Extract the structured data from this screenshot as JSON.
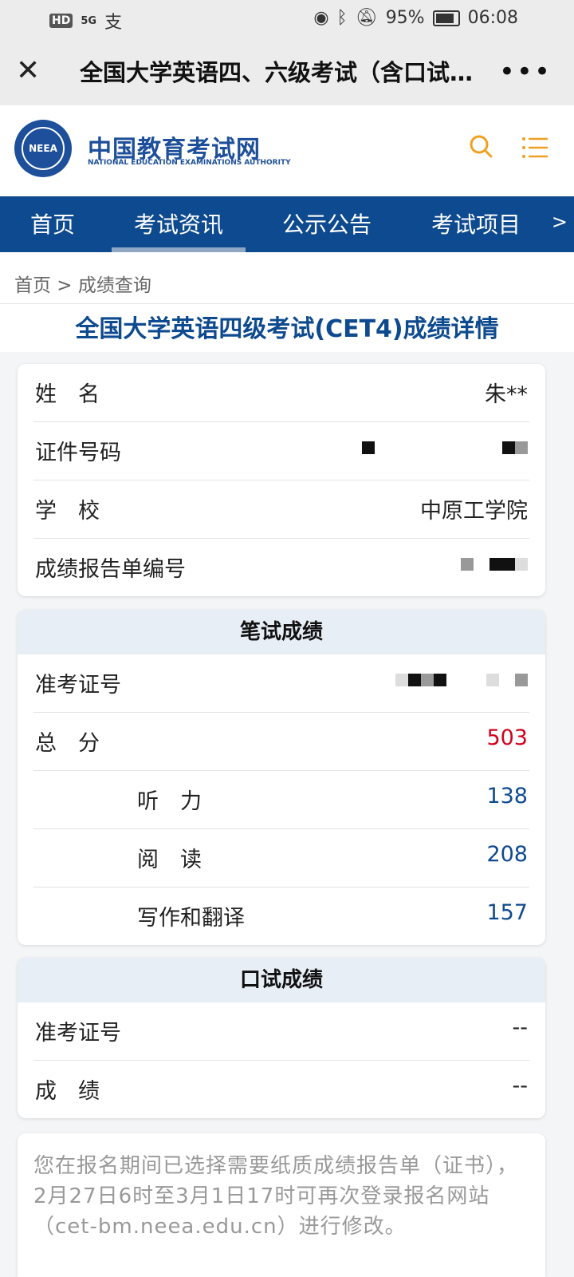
{
  "status_bar": {
    "hd": "HD",
    "network": "5G",
    "app_icons": "支",
    "battery": "95%",
    "time": "06:08"
  },
  "titlebar": {
    "title": "全国大学英语四、六级考试（含口试…"
  },
  "site": {
    "name_cn": "中国教育考试网",
    "name_en": "NATIONAL EDUCATION EXAMINATIONS AUTHORITY",
    "emblem_text": "NEEA"
  },
  "nav": {
    "items": [
      "首页",
      "考试资讯",
      "公示公告",
      "考试项目"
    ],
    "more": ">"
  },
  "breadcrumb": "首页 > 成绩查询",
  "page_title": "全国大学英语四级考试(CET4)成绩详情",
  "info": {
    "name_label": "姓　名",
    "name_value": "朱**",
    "id_label": "证件号码",
    "school_label": "学　校",
    "school_value": "中原工学院",
    "report_label": "成绩报告单编号"
  },
  "written": {
    "heading": "笔试成绩",
    "ticket_label": "准考证号",
    "total_label": "总　分",
    "total_value": "503",
    "listening_label": "听　力",
    "listening_value": "138",
    "reading_label": "阅　读",
    "reading_value": "208",
    "writing_label": "写作和翻译",
    "writing_value": "157"
  },
  "oral": {
    "heading": "口试成绩",
    "ticket_label": "准考证号",
    "ticket_value": "--",
    "score_label": "成　绩",
    "score_value": "--"
  },
  "note": "您在报名期间已选择需要纸质成绩报告单（证书），2月27日6时至3月1日17时可再次登录报名网站（cet-bm.neea.edu.cn）进行修改。"
}
